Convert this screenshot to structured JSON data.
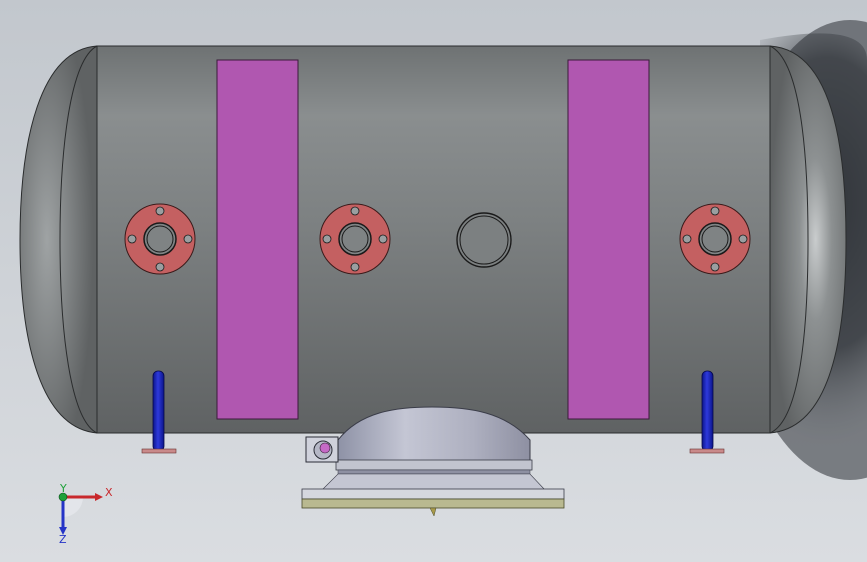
{
  "viewport": {
    "background_top": "#c3c8ce",
    "background_bottom": "#d9dde1"
  },
  "model": {
    "shell_color": "#7f8384",
    "saddle_color": "#b057b0",
    "flange_color": "#c46061",
    "pipe_color": "#1d28c0",
    "base_color": "#b9b990",
    "flanges": [
      {
        "id": "nozzle-flange-1"
      },
      {
        "id": "nozzle-flange-2"
      },
      {
        "id": "nozzle-flange-3"
      }
    ]
  },
  "triad": {
    "x_label": "X",
    "y_label": "Y",
    "z_label": "Z",
    "x_color": "#c8282c",
    "y_color": "#1fa13a",
    "z_color": "#2534c7"
  }
}
